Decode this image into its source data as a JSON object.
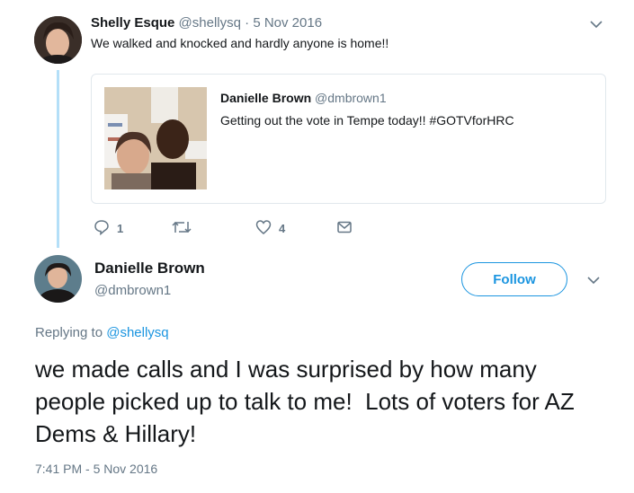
{
  "tweet1": {
    "name": "Shelly Esque",
    "handle": "@shellysq",
    "sep": "·",
    "date": "5 Nov 2016",
    "text": "We walked and knocked and hardly anyone is home!!",
    "actions": {
      "reply_count": "1",
      "like_count": "4"
    }
  },
  "quoted": {
    "name": "Danielle Brown",
    "handle": "@dmbrown1",
    "text": "Getting out the vote in Tempe today!! #GOTVforHRC"
  },
  "tweet2": {
    "name": "Danielle Brown",
    "handle": "@dmbrown1",
    "follow_label": "Follow",
    "replying_prefix": "Replying to",
    "replying_to": "@shellysq",
    "text": "we made calls and I was surprised by how many people picked up to talk to me!  Lots of voters for AZ Dems & Hillary!",
    "timestamp": "7:41 PM - 5 Nov 2016"
  },
  "colors": {
    "accent": "#1b95e0",
    "muted": "#657786",
    "thread_line": "#b4dff8"
  },
  "icons": [
    "chevron-down-icon",
    "reply-icon",
    "retweet-icon",
    "like-icon",
    "message-icon"
  ]
}
